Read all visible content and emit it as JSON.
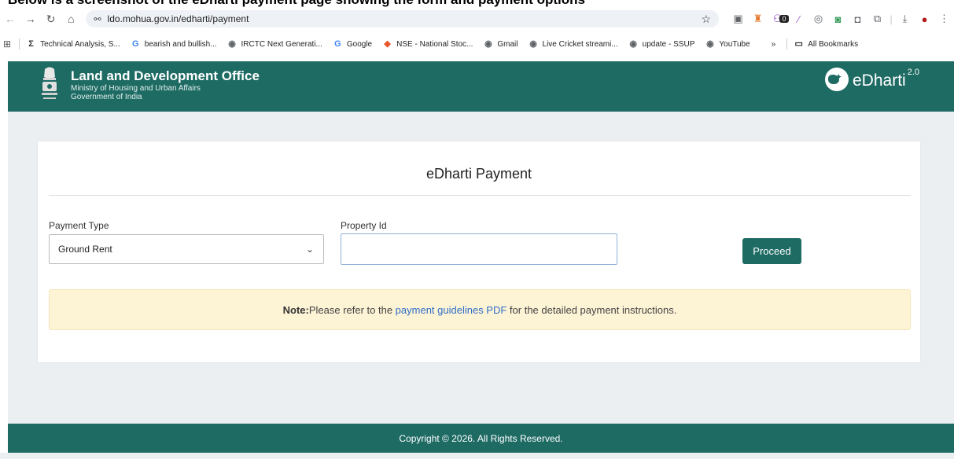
{
  "heading_cut": "Below is a screenshot of the eDharti payment page showing the form and payment options",
  "browser": {
    "url": "ldo.mohua.gov.in/edharti/payment",
    "bookmarks": [
      {
        "label": "Technical Analysis, S...",
        "icon": "sigma-icon",
        "color": "#333333",
        "glyph": "Σ"
      },
      {
        "label": "bearish and bullish...",
        "icon": "google-icon",
        "color": "#4285f4",
        "glyph": "G"
      },
      {
        "label": "IRCTC Next Generati...",
        "icon": "globe-icon",
        "color": "#5f6368",
        "glyph": "◉"
      },
      {
        "label": "Google",
        "icon": "google-icon",
        "color": "#4285f4",
        "glyph": "G"
      },
      {
        "label": "NSE - National Stoc...",
        "icon": "nse-icon",
        "color": "#e8572a",
        "glyph": "◆"
      },
      {
        "label": "Gmail",
        "icon": "globe-icon",
        "color": "#5f6368",
        "glyph": "◉"
      },
      {
        "label": "Live Cricket streami...",
        "icon": "globe-icon",
        "color": "#5f6368",
        "glyph": "◉"
      },
      {
        "label": "update - SSUP",
        "icon": "globe-icon",
        "color": "#5f6368",
        "glyph": "◉"
      },
      {
        "label": "YouTube",
        "icon": "globe-icon",
        "color": "#5f6368",
        "glyph": "◉"
      }
    ],
    "more_label": "»",
    "all_bookmarks": "All Bookmarks",
    "extension_badge": "0"
  },
  "site": {
    "org_title": "Land and Development Office",
    "org_sub1": "Ministry of Housing and Urban Affairs",
    "org_sub2": "Government of India",
    "brand": "eDharti",
    "brand_version": "2.0",
    "header_color": "#1e6b64"
  },
  "form": {
    "title": "eDharti Payment",
    "payment_type_label": "Payment Type",
    "payment_type_value": "Ground Rent",
    "property_id_label": "Property Id",
    "property_id_value": "",
    "proceed_label": "Proceed"
  },
  "note": {
    "prefix": "Note:",
    "text_before": "Please refer to the ",
    "link": "payment guidelines PDF",
    "text_after": " for the detailed payment instructions."
  },
  "footer": {
    "copyright": "Copyright © 2026. All Rights Reserved."
  }
}
